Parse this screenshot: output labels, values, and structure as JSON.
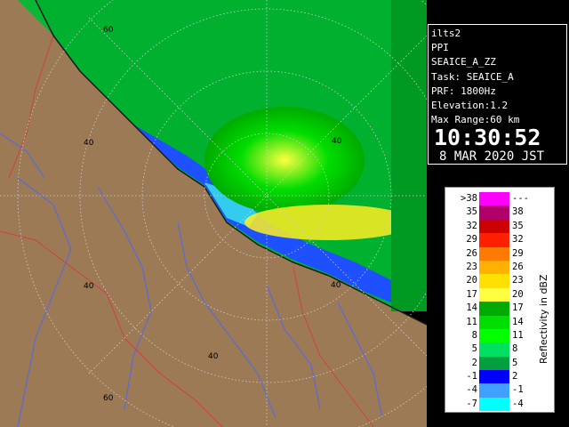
{
  "info": {
    "station": "ilts2",
    "mode": "PPI",
    "product": "SEAICE_A_ZZ",
    "task": "Task: SEAICE_A",
    "prf": "PRF: 1800Hz",
    "elevation": "Elevation:1.2",
    "max_range": "Max Range:60 km",
    "time": "10:30:52",
    "date": "8 MAR 2020 JST"
  },
  "rings": {
    "labels": [
      "60",
      "40",
      "40",
      "40",
      "40",
      "60"
    ]
  },
  "legend": {
    "unit": "Reflectivity in dBZ",
    "rows": [
      {
        "lo": ">38",
        "hi": "---",
        "color": "#ff00ff"
      },
      {
        "lo": "35",
        "hi": "38",
        "color": "#b0006a"
      },
      {
        "lo": "32",
        "hi": "35",
        "color": "#cc0000"
      },
      {
        "lo": "29",
        "hi": "32",
        "color": "#ff2000"
      },
      {
        "lo": "26",
        "hi": "29",
        "color": "#ff7a00"
      },
      {
        "lo": "23",
        "hi": "26",
        "color": "#ffb000"
      },
      {
        "lo": "20",
        "hi": "23",
        "color": "#ffe000"
      },
      {
        "lo": "17",
        "hi": "20",
        "color": "#ffff40"
      },
      {
        "lo": "14",
        "hi": "17",
        "color": "#00aa00"
      },
      {
        "lo": "11",
        "hi": "14",
        "color": "#00dd00"
      },
      {
        "lo": "8",
        "hi": "11",
        "color": "#00ff00"
      },
      {
        "lo": "5",
        "hi": "8",
        "color": "#00e060"
      },
      {
        "lo": "2",
        "hi": "5",
        "color": "#00a040"
      },
      {
        "lo": "-1",
        "hi": "2",
        "color": "#0000ff"
      },
      {
        "lo": "-4",
        "hi": "-1",
        "color": "#3fa0ff"
      },
      {
        "lo": "-7",
        "hi": "-4",
        "color": "#00ffff"
      }
    ]
  },
  "colors": {
    "land": "#9c7a56",
    "sea": "#000000",
    "rings": "#cfcfcf",
    "coast": "#1a1a1a",
    "rivers": "#5a6cd6",
    "borders": "#d04040"
  }
}
